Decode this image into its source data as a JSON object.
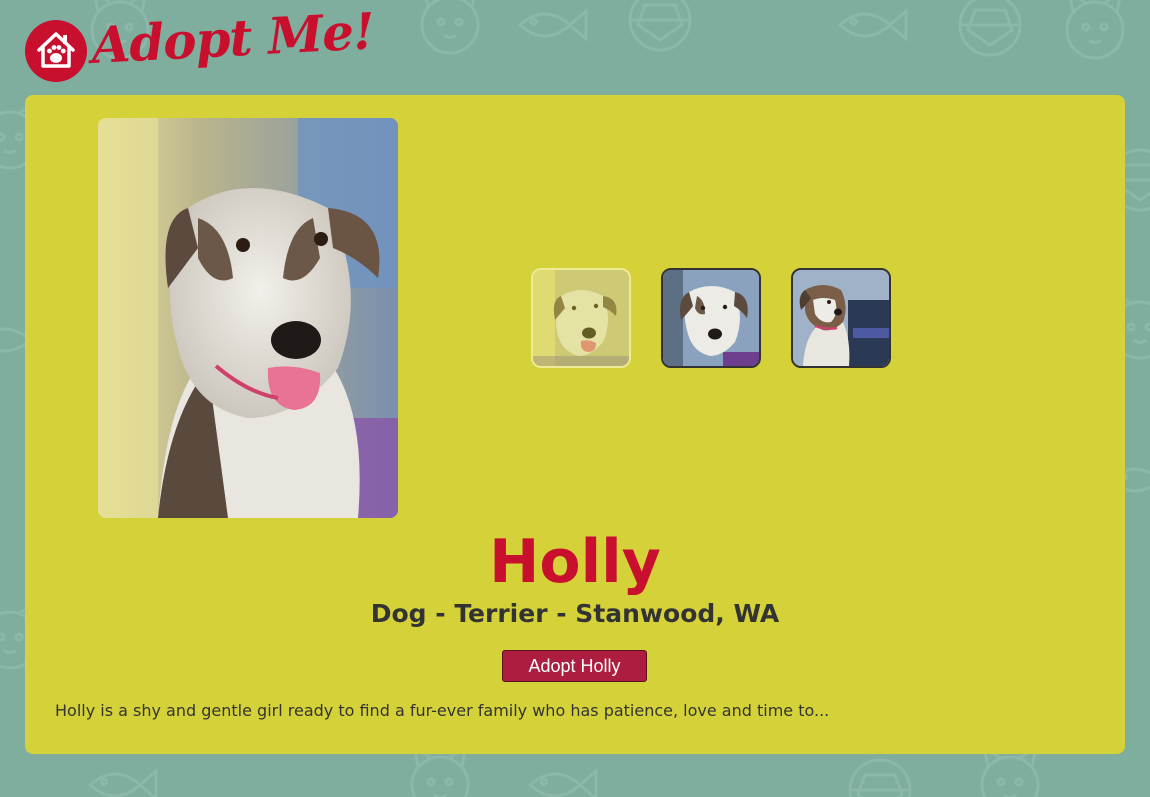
{
  "site": {
    "logo_text": "Adopt Me!",
    "brand_color": "#c8102e",
    "background_color": "#7fad9e"
  },
  "pet": {
    "name": "Holly",
    "meta": "Dog - Terrier - Stanwood, WA",
    "adopt_label": "Adopt Holly",
    "description": "Holly is a shy and gentle girl ready to find a fur-ever family who has patience, love and time to...",
    "card_color": "#d5d239",
    "button_color": "#ad1d3f"
  },
  "gallery": {
    "thumbnails": [
      {
        "alt": "Holly photo 1",
        "selected": true
      },
      {
        "alt": "Holly photo 2",
        "selected": false
      },
      {
        "alt": "Holly photo 3",
        "selected": false
      }
    ]
  }
}
